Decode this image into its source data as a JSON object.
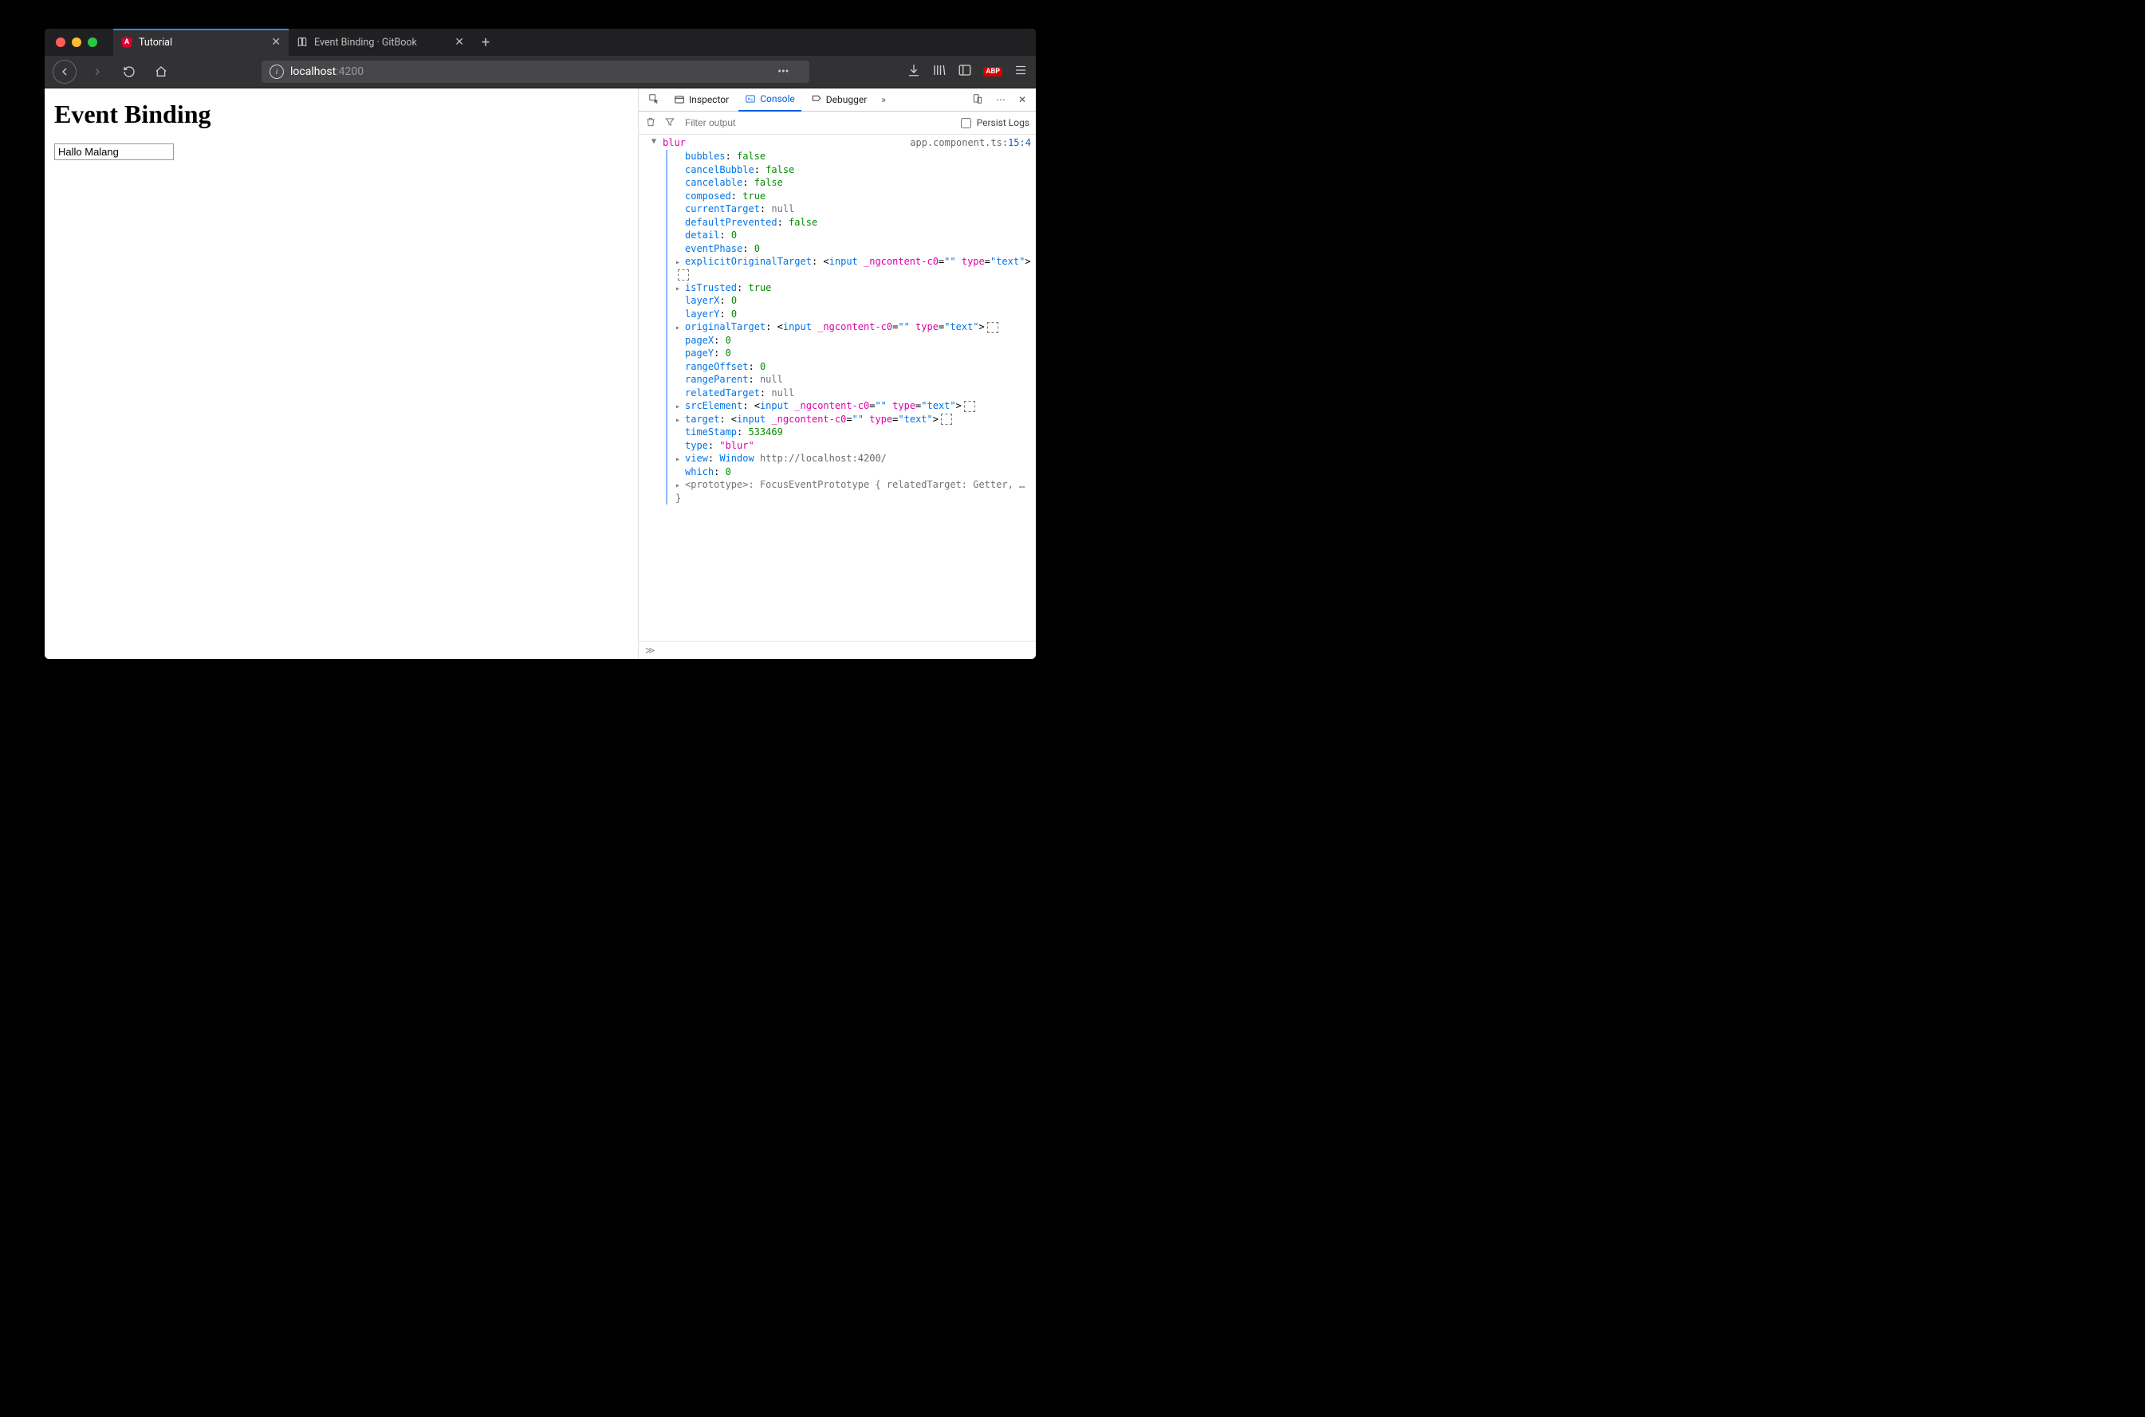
{
  "browser": {
    "tabs": [
      {
        "title": "Tutorial",
        "active": true,
        "icon": "angular"
      },
      {
        "title": "Event Binding · GitBook",
        "active": false,
        "icon": "book"
      }
    ],
    "newtab_glyph": "+",
    "url": {
      "host": "localhost",
      "port": ":4200"
    },
    "url_actions": {
      "dots": "•••"
    },
    "right_icons": {
      "abp": "ABP"
    }
  },
  "page": {
    "heading": "Event Binding",
    "input_value": "Hallo Malang"
  },
  "devtools": {
    "toolbar": {
      "inspector": "Inspector",
      "console": "Console",
      "debugger": "Debugger",
      "more": "»",
      "close": "✕"
    },
    "filter": {
      "placeholder": "Filter output",
      "persist_label": "Persist Logs"
    },
    "message": {
      "event": "blur",
      "source_file": "app.component.ts",
      "source_line": "15",
      "source_col": "4",
      "props": {
        "bubbles": "false",
        "cancelBubble": "false",
        "cancelable": "false",
        "composed": "true",
        "currentTarget": "null",
        "defaultPrevented": "false",
        "detail": "0",
        "eventPhase": "0",
        "explicitOriginalTarget": {
          "tag": "input",
          "attrs": "_ngcontent-c0=\"\" type=\"text\""
        },
        "isTrusted": "true",
        "layerX": "0",
        "layerY": "0",
        "originalTarget": {
          "tag": "input",
          "attrs": "_ngcontent-c0=\"\" type=\"text\""
        },
        "pageX": "0",
        "pageY": "0",
        "rangeOffset": "0",
        "rangeParent": "null",
        "relatedTarget": "null",
        "srcElement": {
          "tag": "input",
          "attrs": "_ngcontent-c0=\"\" type=\"text\""
        },
        "target": {
          "tag": "input",
          "attrs": "_ngcontent-c0=\"\" type=\"text\""
        },
        "timeStamp": "533469",
        "type": "\"blur\"",
        "view_label": "Window",
        "view_url": "http://localhost:4200/",
        "which": "0",
        "prototype": "<prototype>: FocusEventPrototype { relatedTarget: Getter, … }"
      }
    },
    "prompt": "≫"
  }
}
